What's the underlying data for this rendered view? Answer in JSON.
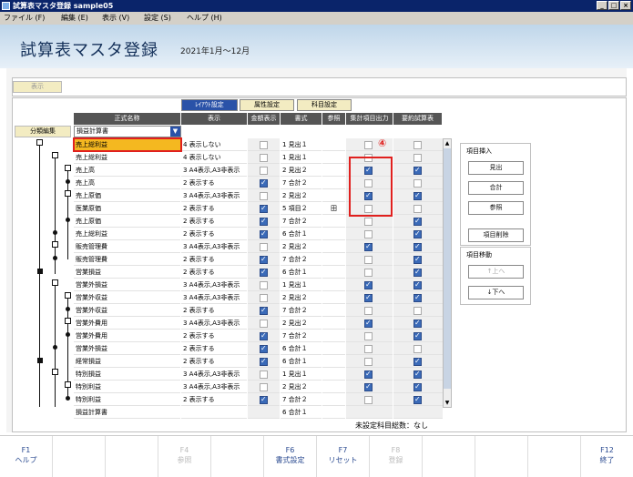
{
  "window": {
    "title": "試算表マスタ登録 sample05"
  },
  "menu": [
    "ファイル (F)",
    "編集 (E)",
    "表示 (V)",
    "設定 (S)",
    "ヘルプ (H)"
  ],
  "header": {
    "title": "試算表マスタ登録",
    "period": "2021年1月～12月"
  },
  "toolbar": {
    "show": "表示"
  },
  "tabs": [
    "ﾚｲｱｳﾄ設定",
    "属性設定",
    "科目設定"
  ],
  "columns": {
    "name": "正式名称",
    "hyoji": "表示",
    "gaku": "金額表示",
    "shoshiki": "書式",
    "sansho": "参照",
    "shukei": "集計項目出力",
    "youyaku": "要約試算表"
  },
  "classify_button": "分類編集",
  "select": {
    "value": "損益計算書"
  },
  "annotation": "④",
  "rows": [
    {
      "name": "売上総利益",
      "hyoji": "4 表示しない",
      "gaku": false,
      "shoshiki": "1 見出１",
      "sansho": "",
      "shukei": false,
      "youyaku": false
    },
    {
      "name": "売上総利益",
      "hyoji": "4 表示しない",
      "gaku": false,
      "shoshiki": "1 見出１",
      "sansho": "",
      "shukei": false,
      "youyaku": false
    },
    {
      "name": "売上高",
      "hyoji": "3 A4表示,A3非表示",
      "gaku": false,
      "shoshiki": "2 見出２",
      "sansho": "",
      "shukei": true,
      "youyaku": true
    },
    {
      "name": "売上高",
      "hyoji": "2 表示する",
      "gaku": true,
      "shoshiki": "7 合計２",
      "sansho": "",
      "shukei": false,
      "youyaku": false
    },
    {
      "name": "売上原価",
      "hyoji": "3 A4表示,A3非表示",
      "gaku": false,
      "shoshiki": "2 見出２",
      "sansho": "",
      "shukei": true,
      "youyaku": true
    },
    {
      "name": "医業原価",
      "hyoji": "2 表示する",
      "gaku": true,
      "shoshiki": "5 項目２",
      "sansho": "田",
      "shukei": false,
      "youyaku": false
    },
    {
      "name": "売上原価",
      "hyoji": "2 表示する",
      "gaku": true,
      "shoshiki": "7 合計２",
      "sansho": "",
      "shukei": false,
      "youyaku": true
    },
    {
      "name": "売上総利益",
      "hyoji": "2 表示する",
      "gaku": true,
      "shoshiki": "6 合計１",
      "sansho": "",
      "shukei": false,
      "youyaku": true
    },
    {
      "name": "販売管理費",
      "hyoji": "3 A4表示,A3非表示",
      "gaku": false,
      "shoshiki": "2 見出２",
      "sansho": "",
      "shukei": true,
      "youyaku": true
    },
    {
      "name": "販売管理費",
      "hyoji": "2 表示する",
      "gaku": true,
      "shoshiki": "7 合計２",
      "sansho": "",
      "shukei": false,
      "youyaku": true
    },
    {
      "name": "営業損益",
      "hyoji": "2 表示する",
      "gaku": true,
      "shoshiki": "6 合計１",
      "sansho": "",
      "shukei": false,
      "youyaku": true
    },
    {
      "name": "営業外損益",
      "hyoji": "3 A4表示,A3非表示",
      "gaku": false,
      "shoshiki": "1 見出１",
      "sansho": "",
      "shukei": true,
      "youyaku": true
    },
    {
      "name": "営業外収益",
      "hyoji": "3 A4表示,A3非表示",
      "gaku": false,
      "shoshiki": "2 見出２",
      "sansho": "",
      "shukei": true,
      "youyaku": true
    },
    {
      "name": "営業外収益",
      "hyoji": "2 表示する",
      "gaku": true,
      "shoshiki": "7 合計２",
      "sansho": "",
      "shukei": false,
      "youyaku": false
    },
    {
      "name": "営業外費用",
      "hyoji": "3 A4表示,A3非表示",
      "gaku": false,
      "shoshiki": "2 見出２",
      "sansho": "",
      "shukei": true,
      "youyaku": true
    },
    {
      "name": "営業外費用",
      "hyoji": "2 表示する",
      "gaku": true,
      "shoshiki": "7 合計２",
      "sansho": "",
      "shukei": false,
      "youyaku": true
    },
    {
      "name": "営業外損益",
      "hyoji": "2 表示する",
      "gaku": true,
      "shoshiki": "6 合計１",
      "sansho": "",
      "shukei": false,
      "youyaku": false
    },
    {
      "name": "経常損益",
      "hyoji": "2 表示する",
      "gaku": true,
      "shoshiki": "6 合計１",
      "sansho": "",
      "shukei": false,
      "youyaku": true
    },
    {
      "name": "特別損益",
      "hyoji": "3 A4表示,A3非表示",
      "gaku": false,
      "shoshiki": "1 見出１",
      "sansho": "",
      "shukei": true,
      "youyaku": true
    },
    {
      "name": "特別利益",
      "hyoji": "3 A4表示,A3非表示",
      "gaku": false,
      "shoshiki": "2 見出２",
      "sansho": "",
      "shukei": true,
      "youyaku": true
    },
    {
      "name": "特別利益",
      "hyoji": "2 表示する",
      "gaku": true,
      "shoshiki": "7 合計２",
      "sansho": "",
      "shukei": false,
      "youyaku": true
    },
    {
      "name": "損益計算書",
      "hyoji": "",
      "gaku": null,
      "shoshiki": "6 合計１",
      "sansho": "",
      "shukei": null,
      "youyaku": null
    }
  ],
  "side": {
    "insert_title": "項目挿入",
    "midashi": "見出",
    "goukei": "合計",
    "sansho": "参照",
    "delete": "項目削除",
    "move_title": "項目移動",
    "up": "↑上へ",
    "down": "↓下へ"
  },
  "status": "未設定科目総数：なし",
  "fkeys": [
    {
      "key": "F1",
      "label": "ヘルプ",
      "enabled": true
    },
    {
      "key": "F4",
      "label": "参照",
      "enabled": false
    },
    {
      "key": "F6",
      "label": "書式設定",
      "enabled": true
    },
    {
      "key": "F7",
      "label": "リセット",
      "enabled": true
    },
    {
      "key": "F8",
      "label": "登録",
      "enabled": false
    },
    {
      "key": "F12",
      "label": "終了",
      "enabled": true
    }
  ]
}
